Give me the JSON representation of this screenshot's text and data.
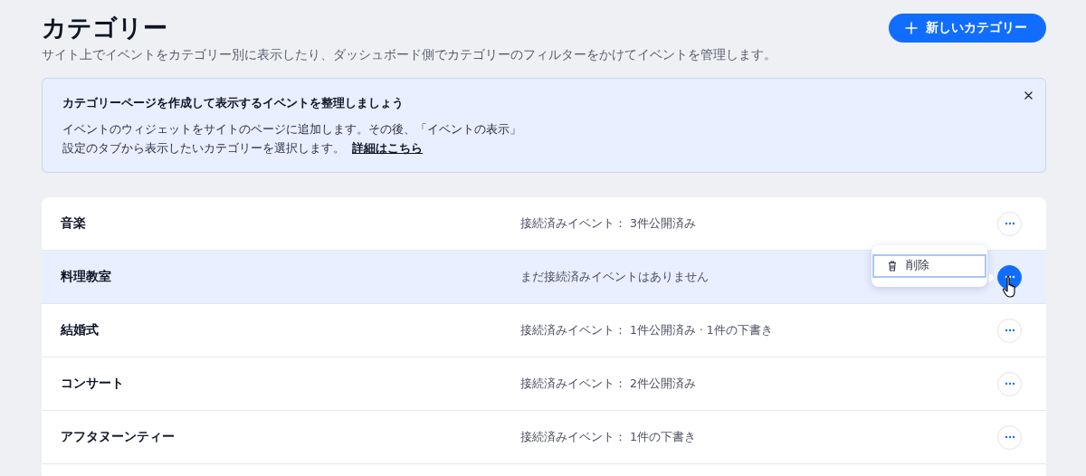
{
  "header": {
    "title": "カテゴリー",
    "subtitle": "サイト上でイベントをカテゴリー別に表示したり、ダッシュボード側でカテゴリーのフィルターをかけてイベントを管理します。",
    "new_button": "新しいカテゴリー"
  },
  "banner": {
    "title": "カテゴリーページを作成して表示するイベントを整理しましょう",
    "lines": [
      "イベントのウィジェットをサイトのページに追加します。その後、「イベントの表示」",
      "設定のタブから表示したいカテゴリーを選択します。"
    ],
    "link": "詳細はこちら"
  },
  "row_menu": {
    "items": [
      {
        "label": "削除",
        "focused": true
      }
    ]
  },
  "rows": [
    {
      "name": "音楽",
      "events": "接続済みイベント： 3件公開済み",
      "selected": false,
      "menu_open": false
    },
    {
      "name": "料理教室",
      "events": "まだ接続済みイベントはありません",
      "selected": true,
      "menu_open": true
    },
    {
      "name": "結婚式",
      "events": "接続済みイベント： 1件公開済み · 1件の下書き",
      "selected": false,
      "menu_open": false
    },
    {
      "name": "コンサート",
      "events": "接続済みイベント： 2件公開済み",
      "selected": false,
      "menu_open": false
    },
    {
      "name": "アフタヌーンティー",
      "events": "接続済みイベント： 1件の下書き",
      "selected": false,
      "menu_open": false
    }
  ]
}
